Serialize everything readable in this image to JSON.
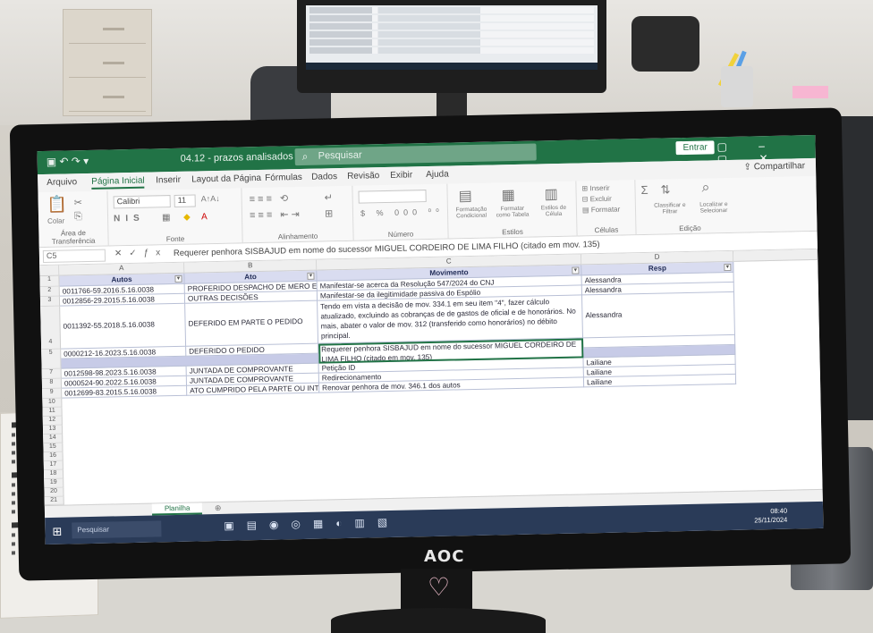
{
  "excel": {
    "title": "04.12 - prazos analisados - Excel",
    "search_placeholder": "Pesquisar",
    "enter_label": "Entrar",
    "share_label": "Compartilhar",
    "tabs": [
      "Arquivo",
      "Página Inicial",
      "Inserir",
      "Layout da Página",
      "Fórmulas",
      "Dados",
      "Revisão",
      "Exibir",
      "Ajuda"
    ],
    "ribbon_groups": [
      "Área de Transferência",
      "Fonte",
      "Alinhamento",
      "Número",
      "Estilos",
      "Células",
      "Edição"
    ],
    "ribbon_labels": {
      "paste": "Colar",
      "font_name": "Calibri",
      "font_size": "11",
      "conditional_format": "Formatação Condicional",
      "format_table": "Formatar como Tabela",
      "cell_styles": "Estilos de Célula",
      "insert": "Inserir",
      "delete": "Excluir",
      "format": "Formatar",
      "sort_filter": "Classificar e Filtrar",
      "find_select": "Localizar e Selecionar"
    },
    "name_box": "C5",
    "formula": "Requerer penhora SISBAJUD em nome do sucessor MIGUEL CORDEIRO DE LIMA FILHO (citado em mov. 135)",
    "columns": [
      "A",
      "B",
      "C",
      "D"
    ],
    "headers": [
      "Autos",
      "Ato",
      "Movimento",
      "Resp"
    ],
    "rows": [
      {
        "num": "2",
        "autos": "0011766-59.2016.5.16.0038",
        "ato": "PROFERIDO DESPACHO DE MERO EXPEDIENTE",
        "mov": "Manifestar-se acerca da Resolução 547/2024 do CNJ",
        "resp": "Alessandra"
      },
      {
        "num": "3",
        "autos": "0012856-29.2015.5.16.0038",
        "ato": "OUTRAS DECISÕES",
        "mov": "Manifestar-se da ilegitimidade passiva do Espólio",
        "resp": "Alessandra"
      },
      {
        "num": "4",
        "autos": "0011392-55.2018.5.16.0038",
        "ato": "DEFERIDO EM PARTE O PEDIDO",
        "mov": "Tendo em vista a decisão de mov. 334.1 em seu item \"4\", fazer cálculo atualizado, excluindo as cobranças de de gastos de oficial e de honorários. No mais, abater o valor de mov. 312 (transferido como honorários) no débito principal.",
        "resp": "Alessandra"
      },
      {
        "num": "5",
        "autos": "0000212-16.2023.5.16.0038",
        "ato": "DEFERIDO O PEDIDO",
        "mov": "Requerer penhora SISBAJUD em nome do sucessor MIGUEL CORDEIRO DE LIMA FILHO (citado em mov. 135)",
        "resp": ""
      },
      {
        "num": "7",
        "autos": "0012598-98.2023.5.16.0038",
        "ato": "JUNTADA DE COMPROVANTE",
        "mov": "Petição ID",
        "resp": "Lailiane"
      },
      {
        "num": "8",
        "autos": "0000524-90.2022.5.16.0038",
        "ato": "JUNTADA DE COMPROVANTE",
        "mov": "Redirecionamento",
        "resp": "Lailiane"
      },
      {
        "num": "9",
        "autos": "0012699-83.2015.5.16.0038",
        "ato": "ATO CUMPRIDO PELA PARTE OU INTERESSADO",
        "mov": "Renovar penhora de mov. 346.1 dos autos",
        "resp": "Lailiane"
      }
    ],
    "empty_rows": [
      "10",
      "11",
      "12",
      "13",
      "14",
      "15",
      "16",
      "17",
      "18",
      "19",
      "20",
      "21"
    ],
    "sheet_name": "Planilha",
    "taskbar_search": "Pesquisar",
    "clock_time": "08:40",
    "clock_date": "25/11/2024"
  },
  "monitor_brand": "AOC"
}
